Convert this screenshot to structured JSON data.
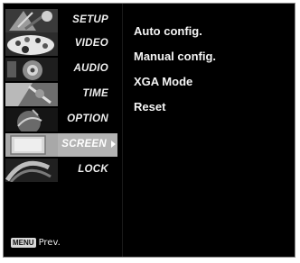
{
  "sidebar": {
    "items": [
      {
        "label": "SETUP",
        "icon": "satellite-dish-icon"
      },
      {
        "label": "VIDEO",
        "icon": "palette-icon"
      },
      {
        "label": "AUDIO",
        "icon": "speaker-icon"
      },
      {
        "label": "TIME",
        "icon": "clock-icon"
      },
      {
        "label": "OPTION",
        "icon": "option-globe-icon"
      },
      {
        "label": "SCREEN",
        "icon": "monitor-icon",
        "active": true
      },
      {
        "label": "LOCK",
        "icon": "padlock-icon"
      }
    ]
  },
  "submenu": {
    "items": [
      "Auto config.",
      "Manual config.",
      "XGA Mode",
      "Reset"
    ]
  },
  "footer": {
    "key_label": "MENU",
    "action_label": "Prev."
  },
  "colors": {
    "background": "#000000",
    "active_highlight": "#b3b3b3",
    "text": "#f0f0f0"
  }
}
